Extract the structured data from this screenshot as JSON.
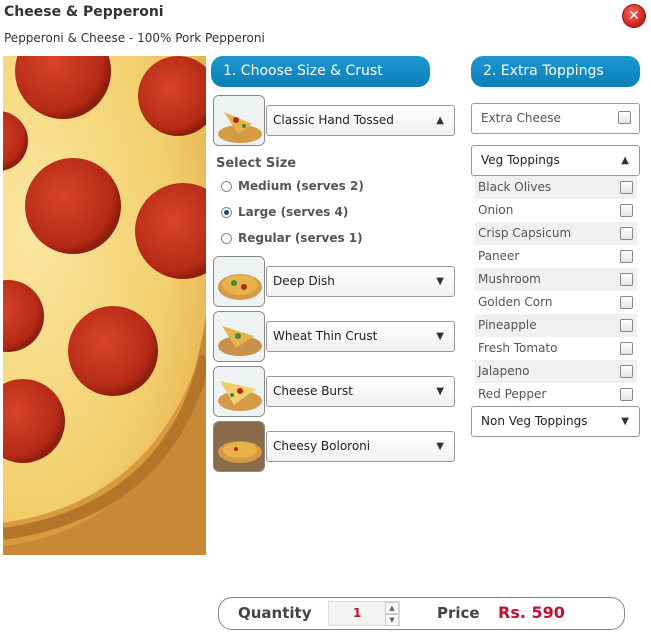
{
  "dialog": {
    "title": "Cheese & Pepperoni",
    "subtitle": "Pepperoni & Cheese - 100% Pork Pepperoni",
    "close_icon": "close-icon"
  },
  "section1": {
    "title": "1. Choose Size & Crust"
  },
  "section2": {
    "title": "2. Extra Toppings"
  },
  "crusts": [
    {
      "label": "Classic Hand Tossed",
      "expanded": true
    },
    {
      "label": "Deep Dish",
      "expanded": false
    },
    {
      "label": "Wheat Thin Crust",
      "expanded": false
    },
    {
      "label": "Cheese Burst",
      "expanded": false
    },
    {
      "label": "Cheesy Boloroni",
      "expanded": false
    }
  ],
  "size": {
    "heading": "Select Size",
    "options": [
      {
        "label": "Medium (serves 2)",
        "selected": false
      },
      {
        "label": "Large (serves 4)",
        "selected": true
      },
      {
        "label": "Regular (serves 1)",
        "selected": false
      }
    ]
  },
  "toppings": {
    "extra_cheese": "Extra Cheese",
    "veg_header": "Veg Toppings",
    "veg_items": [
      "Black Olives",
      "Onion",
      "Crisp Capsicum",
      "Paneer",
      "Mushroom",
      "Golden Corn",
      "Pineapple",
      "Fresh Tomato",
      "Jalapeno",
      "Red Pepper"
    ],
    "non_veg_header": "Non Veg Toppings"
  },
  "order": {
    "quantity_label": "Quantity",
    "quantity_value": "1",
    "price_label": "Price",
    "price_value": "Rs. 590"
  },
  "colors": {
    "accent": "#0a7fba",
    "price": "#c01030",
    "close": "#c8201a"
  }
}
